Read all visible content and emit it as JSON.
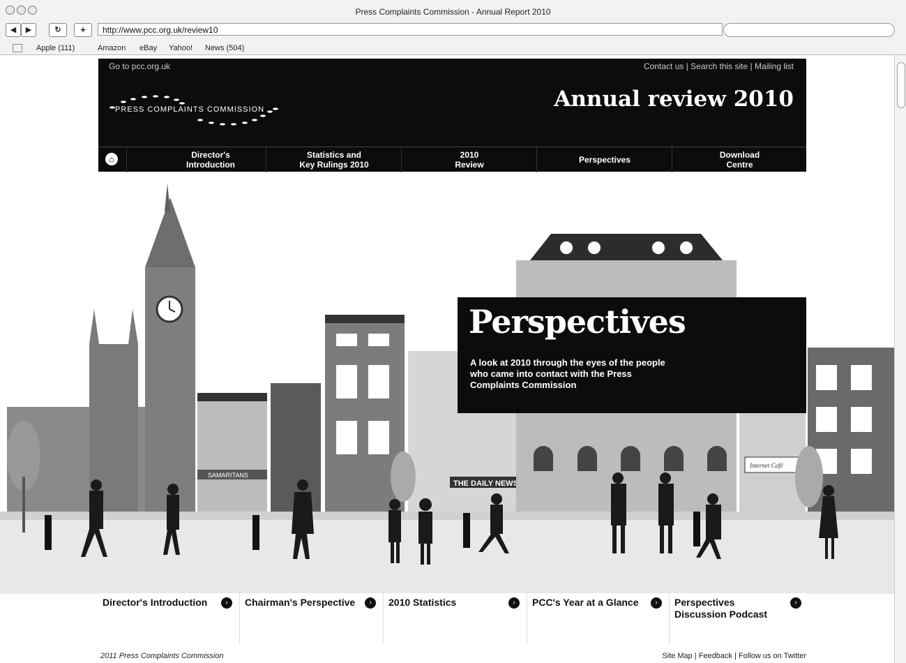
{
  "window": {
    "title": "Press Complaints Commission - Annual Report 2010"
  },
  "toolbar": {
    "url": "http://www.pcc.org.uk/review10"
  },
  "bookmarks": [
    "Apple (111)",
    "Amazon",
    "eBay",
    "Yahoo!",
    "News (504)"
  ],
  "header": {
    "goto": "Go to pcc.org.uk",
    "top_links": "Contact us | Search this site | Mailing list",
    "logo_text": "PRESS COMPLAINTS COMMISSION",
    "title": "Annual review 2010"
  },
  "nav": [
    "Director's\nIntroduction",
    "Statistics and\nKey Rulings 2010",
    "2010\nReview",
    "Perspectives",
    "Download\nCentre"
  ],
  "hero": {
    "heading": "Perspectives",
    "text": "A look at 2010 through the eyes of the people who came into contact with the Press Complaints Commission",
    "signs": [
      "SAMARITANS",
      "THE DAILY NEWS",
      "Internet Café"
    ]
  },
  "cards": [
    "Director's Introduction",
    "Chairman's Perspective",
    "2010 Statistics",
    "PCC's Year at a Glance",
    "Perspectives\nDiscussion Podcast"
  ],
  "footer": {
    "copyright": "2011 Press Complaints Commission",
    "links": "Site Map  |  Feedback  |  Follow us on Twitter"
  }
}
